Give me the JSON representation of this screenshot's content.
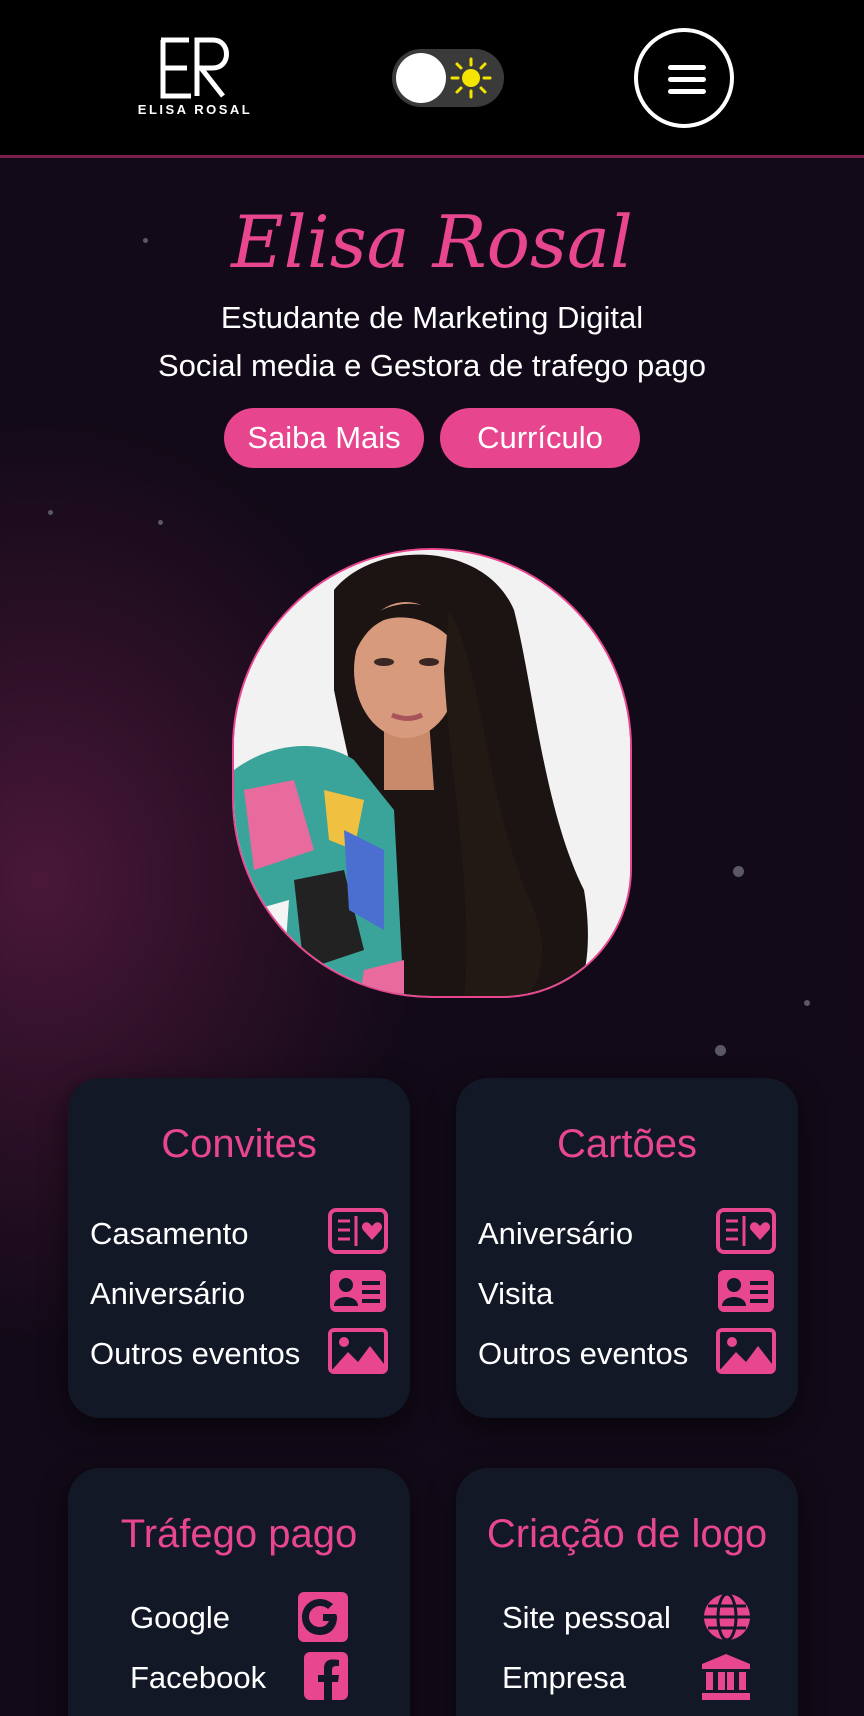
{
  "header": {
    "logo_text": "ELISA ROSAL",
    "theme_toggle_icon": "sun-icon",
    "menu_icon": "hamburger-icon"
  },
  "hero": {
    "name": "Elisa Rosal",
    "subtitle_1": "Estudante de Marketing Digital",
    "subtitle_2": "Social media e Gestora de trafego pago",
    "buttons": [
      "Saiba Mais",
      "Currículo"
    ]
  },
  "cards": [
    {
      "title": "Convites",
      "items": [
        {
          "label": "Casamento",
          "icon": "wedding-card-icon"
        },
        {
          "label": "Aniversário",
          "icon": "id-card-icon"
        },
        {
          "label": "Outros eventos",
          "icon": "image-icon"
        }
      ]
    },
    {
      "title": "Cartões",
      "items": [
        {
          "label": "Aniversário",
          "icon": "wedding-card-icon"
        },
        {
          "label": "Visita",
          "icon": "id-card-icon"
        },
        {
          "label": "Outros eventos",
          "icon": "image-icon"
        }
      ]
    },
    {
      "title": "Tráfego pago",
      "items": [
        {
          "label": "Google",
          "icon": "google-icon"
        },
        {
          "label": "Facebook",
          "icon": "facebook-icon"
        }
      ]
    },
    {
      "title": "Criação de logo",
      "items": [
        {
          "label": "Site pessoal",
          "icon": "globe-icon"
        },
        {
          "label": "Empresa",
          "icon": "bank-icon"
        }
      ]
    }
  ],
  "colors": {
    "accent": "#e8468f",
    "card_bg": "#121826",
    "header_bg": "#000000"
  }
}
